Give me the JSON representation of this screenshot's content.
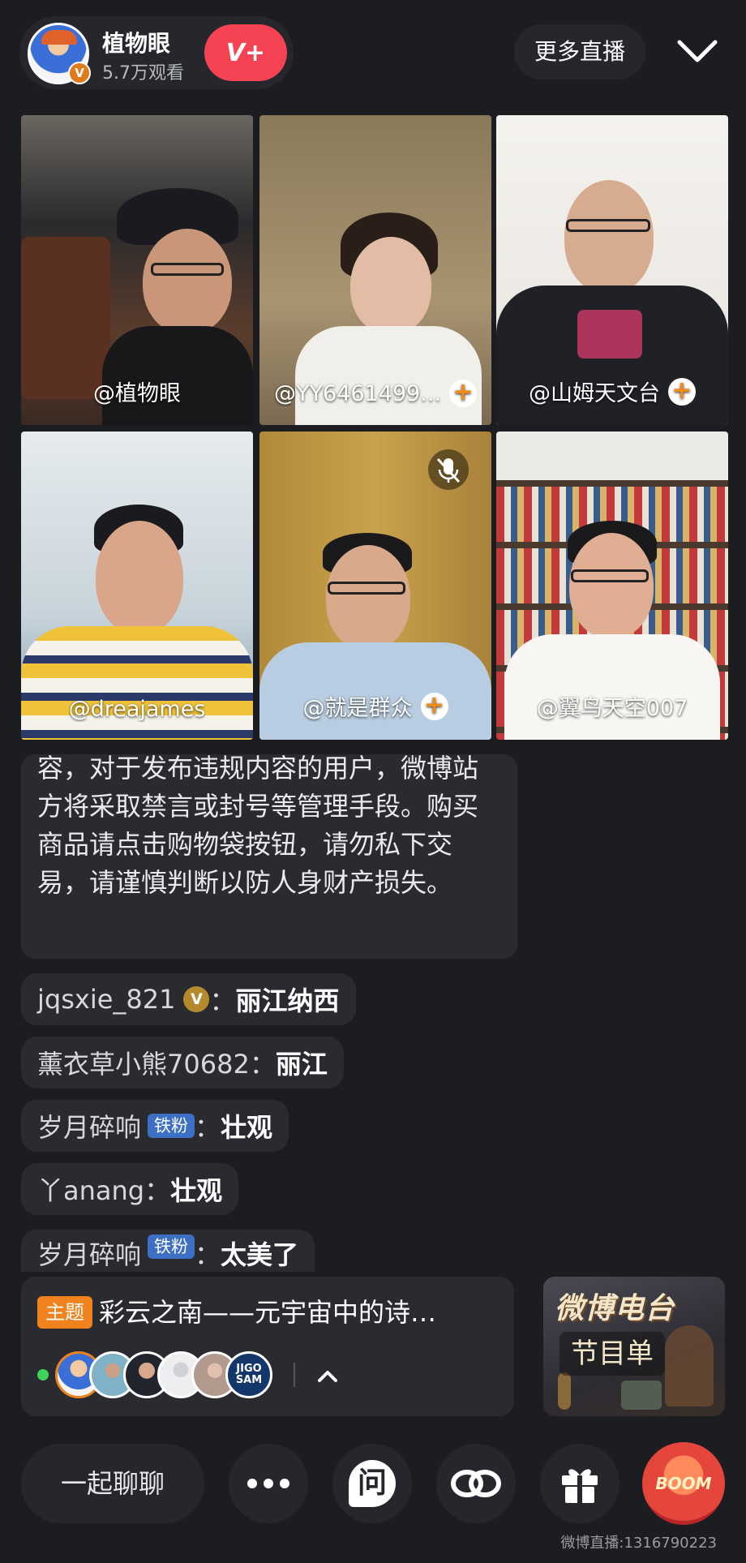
{
  "header": {
    "host_name": "植物眼",
    "host_viewers": "5.7万观看",
    "follow_label": "V+",
    "more_live_label": "更多直播"
  },
  "tiles": [
    {
      "label": "@植物眼"
    },
    {
      "label": "@YY6461499..."
    },
    {
      "label": "@山姆天文台"
    },
    {
      "label": "@dreajames"
    },
    {
      "label": "@就是群众"
    },
    {
      "label": "@翼鸟天空007"
    }
  ],
  "chat": {
    "notice": "容，对于发布违规内容的用户，微博站方将采取禁言或封号等管理手段。购买商品请点击购物袋按钮，请勿私下交易，请谨慎判断以防人身财产损失。",
    "messages": [
      {
        "user": "jqsxie_821",
        "badge": "V",
        "msg": "丽江纳西"
      },
      {
        "user": "薰衣草小熊70682",
        "msg": "丽江"
      },
      {
        "user": "岁月碎响",
        "badge": "铁粉",
        "msg": "壮观"
      },
      {
        "user": "丫anang",
        "msg": "壮观"
      },
      {
        "user": "岁月碎响",
        "badge": "铁粉",
        "msg": "太美了"
      }
    ],
    "colon": "："
  },
  "topic": {
    "tag": "主题",
    "title": "彩云之南——元宇宙中的诗…",
    "avatar_text": "JIGO SAM"
  },
  "radio": {
    "title": "微博电台",
    "subtitle": "节目单"
  },
  "bottom": {
    "chat_label": "一起聊聊",
    "question_label": "问",
    "boom_label": "BOOM"
  },
  "watermark": "微博直播:1316790223",
  "colors": {
    "background": "#1c1d21",
    "follow": "#f64354",
    "accent_orange": "#f0831e",
    "fan_badge": "#3d6fc4",
    "live_dot": "#3ed45a"
  }
}
